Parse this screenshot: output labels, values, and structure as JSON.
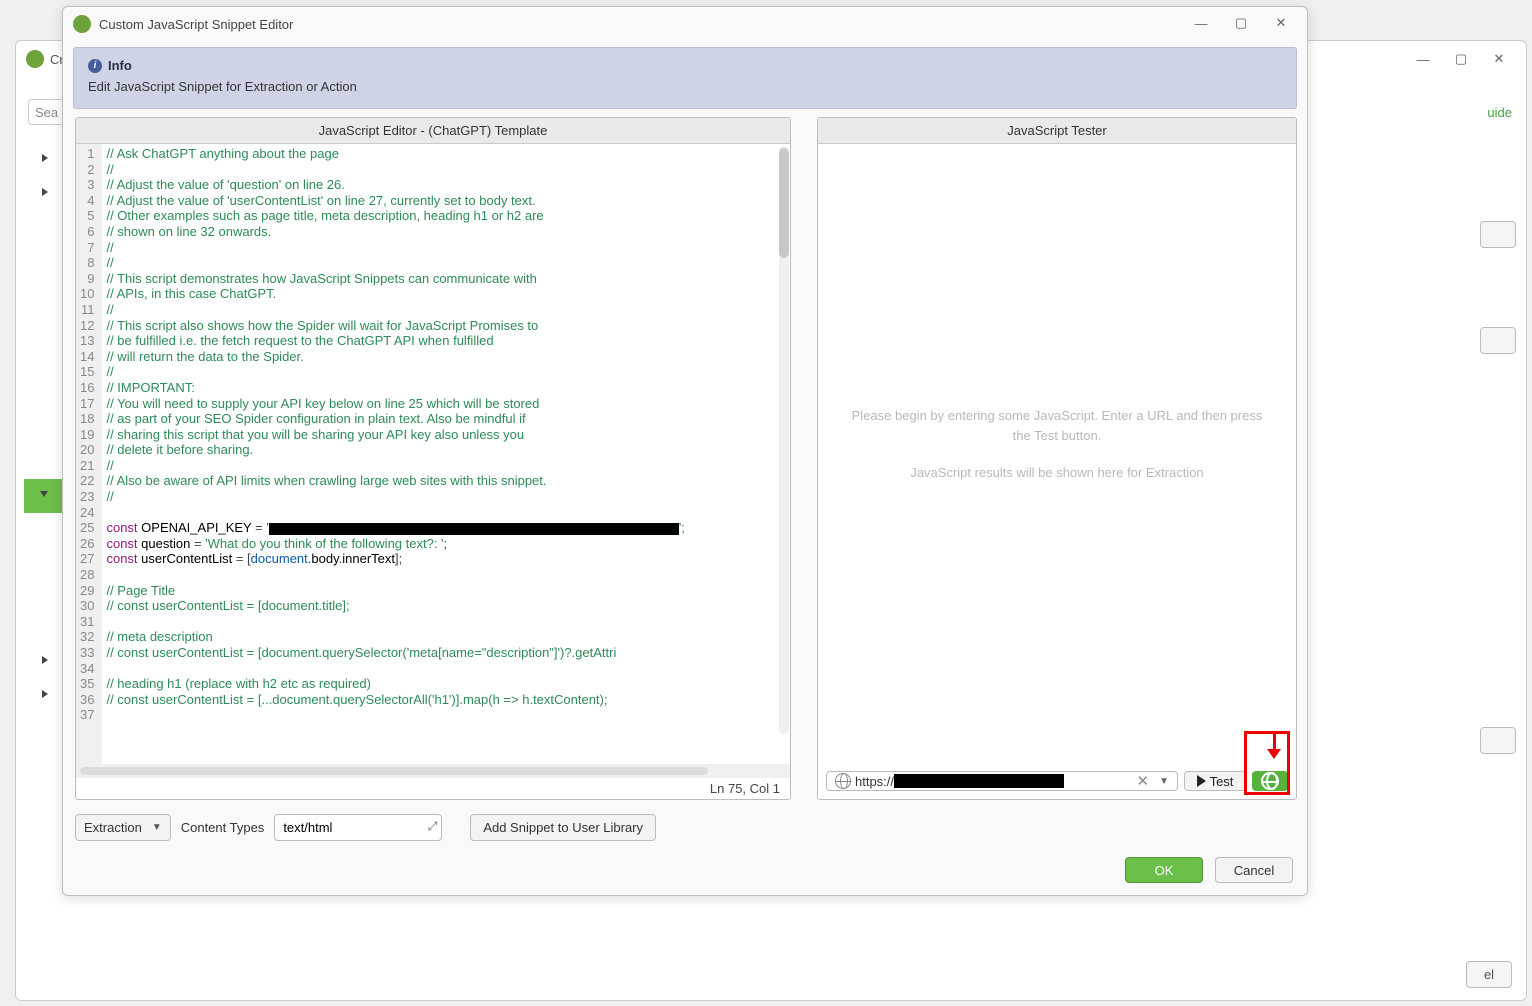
{
  "background": {
    "title_fragment": "Cr",
    "search_placeholder": "Sea",
    "guide_link": "uide",
    "cancel_fragment": "el"
  },
  "dialog": {
    "title": "Custom JavaScript Snippet Editor",
    "window_controls": {
      "min": "—",
      "max": "▢",
      "close": "✕"
    },
    "info": {
      "heading": "Info",
      "body": "Edit JavaScript Snippet for Extraction or Action"
    },
    "editor": {
      "title": "JavaScript Editor - (ChatGPT) Template",
      "status": "Ln 75, Col 1",
      "lines": [
        {
          "n": 1,
          "t": "comment",
          "text": "// Ask ChatGPT anything about the page"
        },
        {
          "n": 2,
          "t": "comment",
          "text": "//"
        },
        {
          "n": 3,
          "t": "comment",
          "text": "// Adjust the value of 'question' on line 26."
        },
        {
          "n": 4,
          "t": "comment",
          "text": "// Adjust the value of 'userContentList' on line 27, currently set to body text."
        },
        {
          "n": 5,
          "t": "comment",
          "text": "// Other examples such as page title, meta description, heading h1 or h2 are"
        },
        {
          "n": 6,
          "t": "comment",
          "text": "// shown on line 32 onwards."
        },
        {
          "n": 7,
          "t": "comment",
          "text": "//"
        },
        {
          "n": 8,
          "t": "comment",
          "text": "//"
        },
        {
          "n": 9,
          "t": "comment",
          "text": "// This script demonstrates how JavaScript Snippets can communicate with"
        },
        {
          "n": 10,
          "t": "comment",
          "text": "// APIs, in this case ChatGPT."
        },
        {
          "n": 11,
          "t": "comment",
          "text": "//"
        },
        {
          "n": 12,
          "t": "comment",
          "text": "// This script also shows how the Spider will wait for JavaScript Promises to"
        },
        {
          "n": 13,
          "t": "comment",
          "text": "// be fulfilled i.e. the fetch request to the ChatGPT API when fulfilled"
        },
        {
          "n": 14,
          "t": "comment",
          "text": "// will return the data to the Spider."
        },
        {
          "n": 15,
          "t": "comment",
          "text": "//"
        },
        {
          "n": 16,
          "t": "comment",
          "text": "// IMPORTANT:"
        },
        {
          "n": 17,
          "t": "comment",
          "text": "// You will need to supply your API key below on line 25 which will be stored"
        },
        {
          "n": 18,
          "t": "comment",
          "text": "// as part of your SEO Spider configuration in plain text. Also be mindful if"
        },
        {
          "n": 19,
          "t": "comment",
          "text": "// sharing this script that you will be sharing your API key also unless you"
        },
        {
          "n": 20,
          "t": "comment",
          "text": "// delete it before sharing."
        },
        {
          "n": 21,
          "t": "comment",
          "text": "//"
        },
        {
          "n": 22,
          "t": "comment",
          "text": "// Also be aware of API limits when crawling large web sites with this snippet."
        },
        {
          "n": 23,
          "t": "comment",
          "text": "//"
        },
        {
          "n": 24,
          "t": "blank",
          "text": ""
        },
        {
          "n": 25,
          "t": "apikey"
        },
        {
          "n": 26,
          "t": "question"
        },
        {
          "n": 27,
          "t": "usercontent"
        },
        {
          "n": 28,
          "t": "blank",
          "text": ""
        },
        {
          "n": 29,
          "t": "comment",
          "text": "// Page Title"
        },
        {
          "n": 30,
          "t": "comment",
          "text": "// const userContentList = [document.title];"
        },
        {
          "n": 31,
          "t": "blank",
          "text": ""
        },
        {
          "n": 32,
          "t": "comment",
          "text": "// meta description"
        },
        {
          "n": 33,
          "t": "comment",
          "text": "// const userContentList = [document.querySelector('meta[name=\"description\"]')?.getAttri"
        },
        {
          "n": 34,
          "t": "blank",
          "text": ""
        },
        {
          "n": 35,
          "t": "comment",
          "text": "// heading h1 (replace with h2 etc as required)"
        },
        {
          "n": 36,
          "t": "comment",
          "text": "// const userContentList = [...document.querySelectorAll('h1')].map(h => h.textContent);"
        },
        {
          "n": 37,
          "t": "blank",
          "text": ""
        }
      ],
      "line25": {
        "kw": "const",
        "var": "OPENAI_API_KEY",
        "eq": " = ",
        "q1": "'",
        "redact_w": 410,
        "q2": "';"
      },
      "line26": {
        "kw": "const",
        "var": "question",
        "eq": " = ",
        "str": "'What do you think of the following text?: '",
        "end": ";"
      },
      "line27": {
        "kw": "const",
        "var": "userContentList",
        "eq": " = [",
        "m1": "document",
        "p1": ".",
        "m2": "body",
        "p2": ".",
        "m3": "innerText",
        "end": "];"
      }
    },
    "tester": {
      "title": "JavaScript Tester",
      "hint1": "Please begin by entering some JavaScript. Enter a URL and then press the Test button.",
      "hint2": "JavaScript results will be shown here for Extraction",
      "url_prefix": "https://",
      "test_label": "Test"
    },
    "footer": {
      "mode": "Extraction",
      "content_types_label": "Content Types",
      "content_types_value": "text/html",
      "add_library": "Add Snippet to User Library",
      "ok": "OK",
      "cancel": "Cancel"
    }
  }
}
